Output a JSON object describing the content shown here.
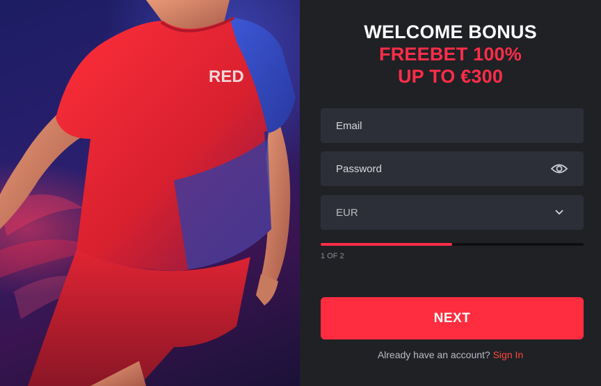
{
  "hero": {
    "jersey_text": "RED"
  },
  "promo": {
    "line1": "WELCOME BONUS",
    "line2": "FREEBET 100%",
    "line3": "UP TO €300"
  },
  "form": {
    "email_placeholder": "Email",
    "password_placeholder": "Password",
    "currency_value": "EUR",
    "progress_fraction": 0.5,
    "step_text": "1 OF 2",
    "next_label": "NEXT",
    "account_prompt": "Already have an account?",
    "signin_label": "Sign In"
  },
  "icons": {
    "password_toggle": "eye-icon",
    "currency_dropdown": "chevron-down-icon"
  },
  "colors": {
    "accent": "#ff2d48",
    "panel_bg": "#1f2125",
    "field_bg": "#2c2f37",
    "link": "#ff4a3d"
  }
}
